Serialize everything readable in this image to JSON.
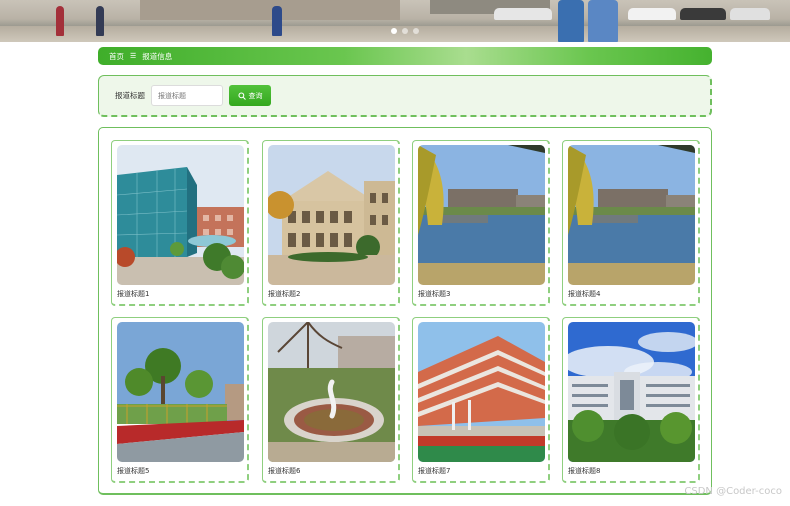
{
  "banner": {
    "slide_count": 3,
    "active_slide": 1
  },
  "breadcrumb": {
    "home": "首页",
    "separator": "☰",
    "current": "报道信息"
  },
  "search": {
    "label": "报道标题",
    "placeholder": "报道标题",
    "value": "",
    "button_label": "查询",
    "button_icon": "search-icon"
  },
  "cards": [
    {
      "title": "报道标题1"
    },
    {
      "title": "报道标题2"
    },
    {
      "title": "报道标题3"
    },
    {
      "title": "报道标题4"
    },
    {
      "title": "报道标题5"
    },
    {
      "title": "报道标题6"
    },
    {
      "title": "报道标题7"
    },
    {
      "title": "报道标题8"
    }
  ],
  "colors": {
    "accent": "#3fae2a",
    "panel_border": "#6fbf5d",
    "panel_bg": "#eef7ea"
  },
  "watermark": "CSDN @Coder-coco"
}
